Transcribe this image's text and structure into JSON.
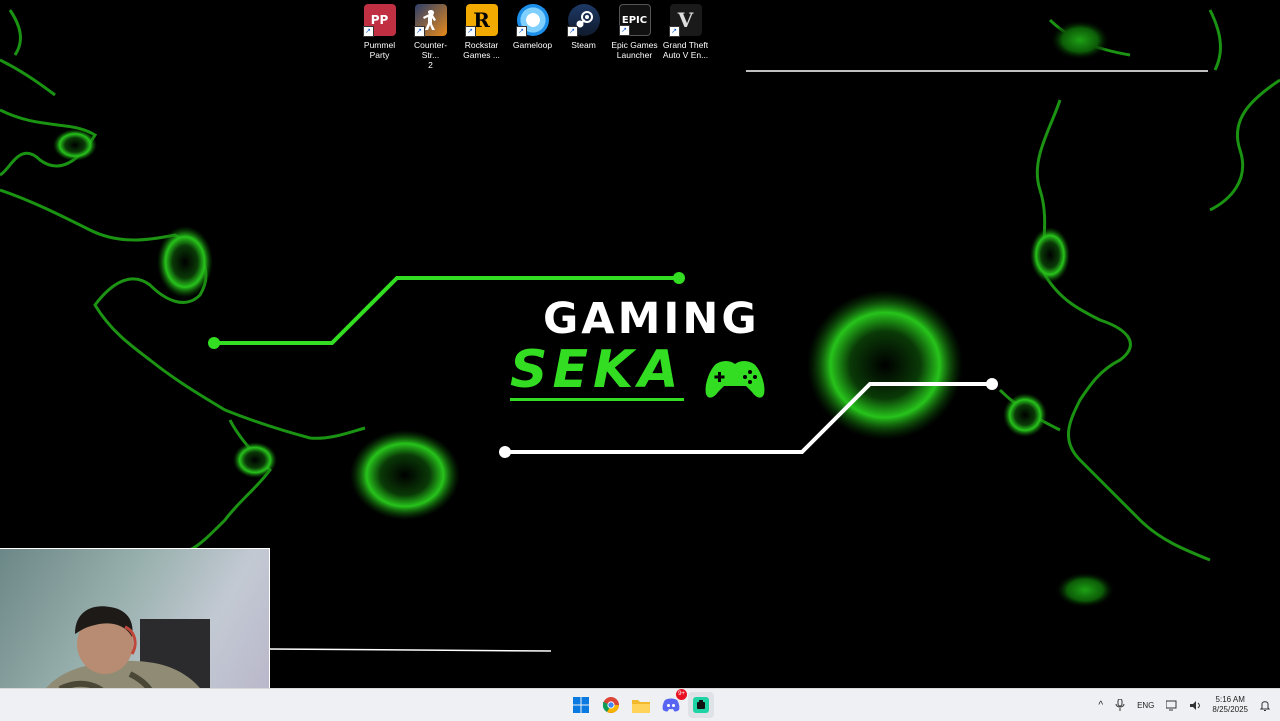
{
  "desktop": {
    "icons": [
      {
        "label": "Pummel\nParty",
        "icon": "pummel-party-icon",
        "color": "#b82a3a"
      },
      {
        "label": "Counter-Str...\n2",
        "icon": "counter-strike-icon",
        "color": "#2c3e6a"
      },
      {
        "label": "Rockstar\nGames ...",
        "icon": "rockstar-icon",
        "color": "#f2a900"
      },
      {
        "label": "Gameloop",
        "icon": "gameloop-icon",
        "color": "#1d8fe8"
      },
      {
        "label": "Steam",
        "icon": "steam-icon",
        "color": "#1b2838"
      },
      {
        "label": "Epic Games\nLauncher",
        "icon": "epic-games-icon",
        "color": "#111111"
      },
      {
        "label": "Grand Theft\nAuto V En...",
        "icon": "gta-v-icon",
        "color": "#1a1a1a"
      }
    ],
    "shortcut_glyph": "↗",
    "icon_glyphs": {
      "pummel": "PP",
      "rockstar": "R",
      "epic": "EPIC",
      "gta": "V"
    }
  },
  "wallpaper": {
    "title_line1": "GAMING",
    "title_line2": "SEKA",
    "accent": "#33dd22"
  },
  "taskbar": {
    "apps": [
      {
        "name": "start-button",
        "icon": "windows-icon"
      },
      {
        "name": "chrome",
        "icon": "chrome-icon"
      },
      {
        "name": "file-explorer",
        "icon": "folder-icon"
      },
      {
        "name": "discord",
        "icon": "discord-icon",
        "badge": "9+"
      },
      {
        "name": "app",
        "icon": "app-icon"
      }
    ],
    "language": "ENG",
    "time": "5:16 AM",
    "date": "8/25/2025",
    "tray_chevron": "^"
  }
}
